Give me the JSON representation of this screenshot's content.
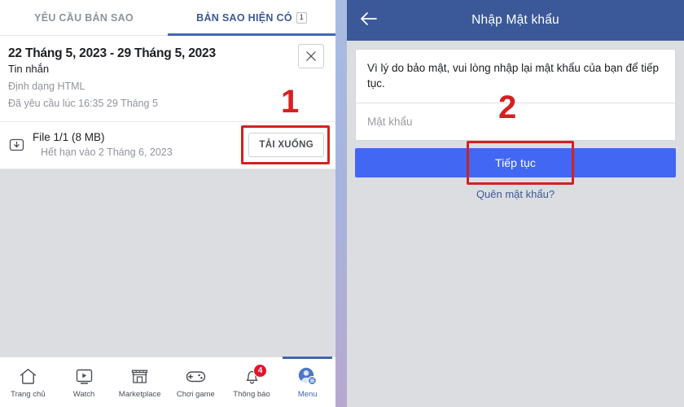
{
  "left": {
    "tabs": [
      {
        "label": "YÊU CẦU BẢN SAO",
        "count": "",
        "active": false
      },
      {
        "label": "BẢN SAO HIỆN CÓ",
        "count": "1",
        "active": true
      }
    ],
    "card": {
      "title": "22 Tháng 5, 2023 - 29 Tháng 5, 2023",
      "subtitle": "Tin nhắn",
      "format": "Định dạng HTML",
      "requested": "Đã yêu cầu lúc 16:35 29 Tháng 5",
      "close_icon": "close-icon"
    },
    "file": {
      "icon": "download-file-icon",
      "name": "File 1/1 (8 MB)",
      "expires": "Hết hạn vào 2 Tháng 6, 2023",
      "download_label": "TẢI XUỐNG"
    },
    "annotation": "1",
    "nav": [
      {
        "label": "Trang chủ",
        "icon": "home-icon",
        "badge": "",
        "active": false
      },
      {
        "label": "Watch",
        "icon": "video-play-icon",
        "badge": "",
        "active": false
      },
      {
        "label": "Marketplace",
        "icon": "storefront-icon",
        "badge": "",
        "active": false
      },
      {
        "label": "Chơi game",
        "icon": "gamepad-icon",
        "badge": "",
        "active": false
      },
      {
        "label": "Thông báo",
        "icon": "bell-icon",
        "badge": "4",
        "active": false
      },
      {
        "label": "Menu",
        "icon": "avatar-menu-icon",
        "badge": "",
        "active": true
      }
    ]
  },
  "right": {
    "header": {
      "title": "Nhập Mật khẩu",
      "back_icon": "back-arrow-icon"
    },
    "note": "Vì lý do bảo mật, vui lòng nhập lại mật khẩu của bạn để tiếp tục.",
    "password_placeholder": "Mật khẩu",
    "password_value": "",
    "continue_label": "Tiếp tục",
    "forgot_label": "Quên mật khẩu?",
    "annotation": "2"
  },
  "colors": {
    "fb_blue": "#3b5998",
    "accent_blue": "#4267f2",
    "highlight_red": "#d42121",
    "badge_red": "#e4142b",
    "page_grey": "#dcdde1"
  }
}
